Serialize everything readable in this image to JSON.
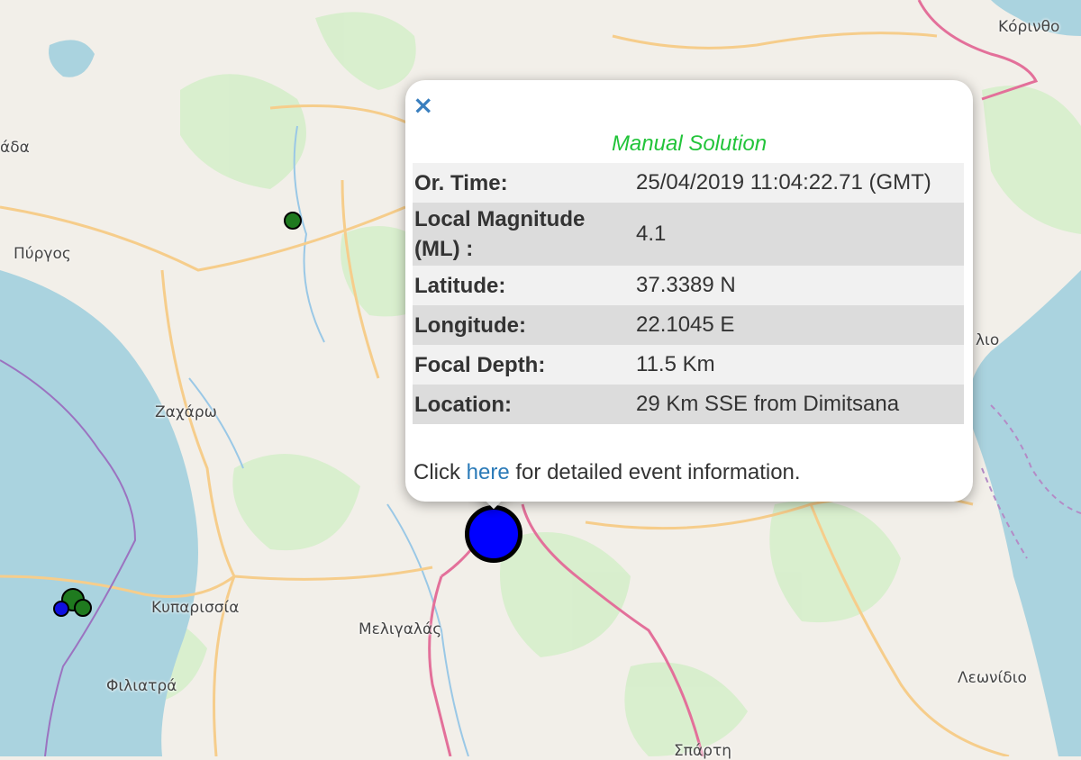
{
  "map": {
    "colors": {
      "land": "#f2efe9",
      "forest": "#d6eecb",
      "water": "#aad3df",
      "road_major": "#e3709a",
      "road_secondary": "#f6cd8b",
      "boundary": "#9b73c0",
      "river": "#9ac8e6"
    },
    "place_labels": {
      "korinthos": "Κόρινθο",
      "ada": "άδα",
      "pyrgos": "Πύργος",
      "zacharo": "Ζαχάρω",
      "kyparissia": "Κυπαρισσία",
      "meligalas": "Μελιγαλάς",
      "filiatra": "Φιλιατρά",
      "leonidio": "Λεωνίδιο",
      "lio": "λιο",
      "sparti": "Σπάρτη"
    }
  },
  "markers": [
    {
      "name": "selected-event",
      "color": "#0000ff"
    },
    {
      "name": "event-north",
      "color": "#1f7a1f"
    },
    {
      "name": "event-west-cluster",
      "color": "#1f7a1f"
    },
    {
      "name": "event-west-blue",
      "color": "#1010e0"
    }
  ],
  "popup": {
    "close_label": "×",
    "title": "Manual Solution",
    "rows": [
      {
        "label": "Or. Time:",
        "value": "25/04/2019 11:04:22.71 (GMT)"
      },
      {
        "label": "Local Magnitude (ML) :",
        "value": "4.1"
      },
      {
        "label": "Latitude:",
        "value": "37.3389 N"
      },
      {
        "label": "Longitude:",
        "value": "22.1045 E"
      },
      {
        "label": "Focal Depth:",
        "value": "11.5 Km"
      },
      {
        "label": "Location:",
        "value": "29 Km SSE from Dimitsana"
      }
    ],
    "footer_prefix": "Click",
    "footer_link": "here",
    "footer_suffix": "for detailed event information."
  }
}
